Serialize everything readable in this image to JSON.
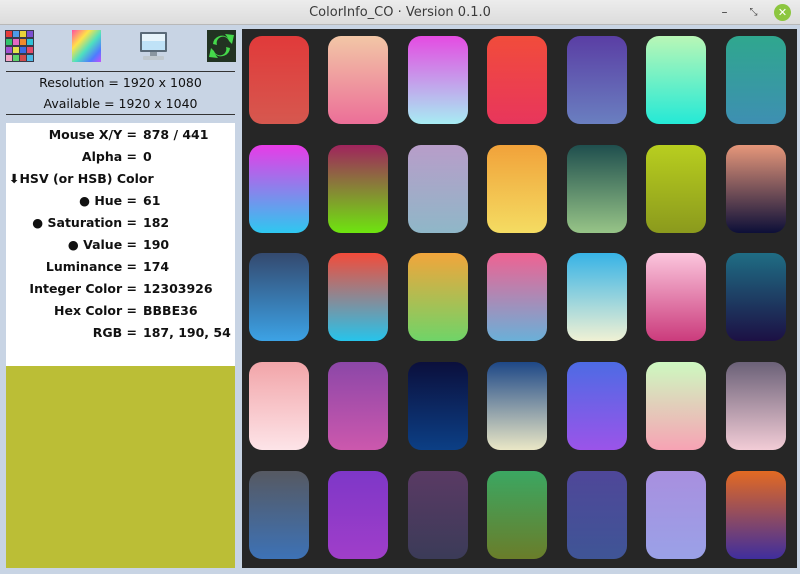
{
  "window": {
    "title": "ColorInfo_CO · Version 0.1.0"
  },
  "toolbar": [
    {
      "name": "palette-grid-icon"
    },
    {
      "name": "color-spectrum-icon"
    },
    {
      "name": "monitor-icon"
    },
    {
      "name": "refresh-icon"
    }
  ],
  "screen": {
    "resolution": "Resolution = 1920 x 1080",
    "available": "Available = 1920 x 1040"
  },
  "info": {
    "mouse": {
      "label": "Mouse X/Y =",
      "value": "878 / 441"
    },
    "alpha": {
      "label": "Alpha =",
      "value": "0"
    },
    "hsv_header": "⬇HSV (or HSB) Color",
    "hue": {
      "label": "● Hue =",
      "value": "61"
    },
    "saturation": {
      "label": "● Saturation =",
      "value": "182"
    },
    "value": {
      "label": "● Value =",
      "value": "190"
    },
    "luminance": {
      "label": "Luminance =",
      "value": "174"
    },
    "integer": {
      "label": "Integer Color =",
      "value": "12303926"
    },
    "hex": {
      "label": "Hex Color =",
      "value": "BBBE36"
    },
    "rgb": {
      "label": "RGB =",
      "value": "187, 190, 54"
    }
  },
  "swatch_color": "#bbbe36",
  "gradients": [
    [
      "#e13a3a",
      "#d6584f"
    ],
    [
      "#f2c7a6",
      "#ec6f98"
    ],
    [
      "#e54be2",
      "#a7ecf3"
    ],
    [
      "#f14c3b",
      "#e8365c"
    ],
    [
      "#5a3ea4",
      "#6a7fc0"
    ],
    [
      "#b9f7b6",
      "#24e9d6"
    ],
    [
      "#2fa78e",
      "#3e8fb2"
    ],
    [
      "#e83be7",
      "#2ec8f0"
    ],
    [
      "#a0245d",
      "#6ee50f"
    ],
    [
      "#b89dc9",
      "#8fb7c8"
    ],
    [
      "#f1a23a",
      "#f4dc62"
    ],
    [
      "#1f4f4e",
      "#97c487"
    ],
    [
      "#b8ce1f",
      "#8b9a1d"
    ],
    [
      "#e6977a",
      "#0c0f38"
    ],
    [
      "#34496f",
      "#3ca2e5"
    ],
    [
      "#f34b3a",
      "#26c4eb"
    ],
    [
      "#f2a53b",
      "#6fd468"
    ],
    [
      "#ef6292",
      "#6ab0d8"
    ],
    [
      "#37b3e6",
      "#f0f1d4"
    ],
    [
      "#fbc6dd",
      "#cb3b7c"
    ],
    [
      "#1f6d84",
      "#1c1044"
    ],
    [
      "#f2a5a9",
      "#fde4e8"
    ],
    [
      "#8c47a8",
      "#cc58ad"
    ],
    [
      "#0b0f3c",
      "#0c3f85"
    ],
    [
      "#1e4887",
      "#eae7c6"
    ],
    [
      "#4d6be4",
      "#9b54e9"
    ],
    [
      "#cdf9c0",
      "#f7a3b4"
    ],
    [
      "#6b6178",
      "#f2ccd6"
    ],
    [
      "#565962",
      "#3d72b6"
    ],
    [
      "#7e37c8",
      "#a03ec9"
    ],
    [
      "#5a3a64",
      "#3b3b58"
    ],
    [
      "#3ba762",
      "#6a7d2a"
    ],
    [
      "#4f4799",
      "#3f5596"
    ],
    [
      "#a88fdf",
      "#9aa1e7"
    ],
    [
      "#e36a22",
      "#3f2e9d"
    ]
  ]
}
